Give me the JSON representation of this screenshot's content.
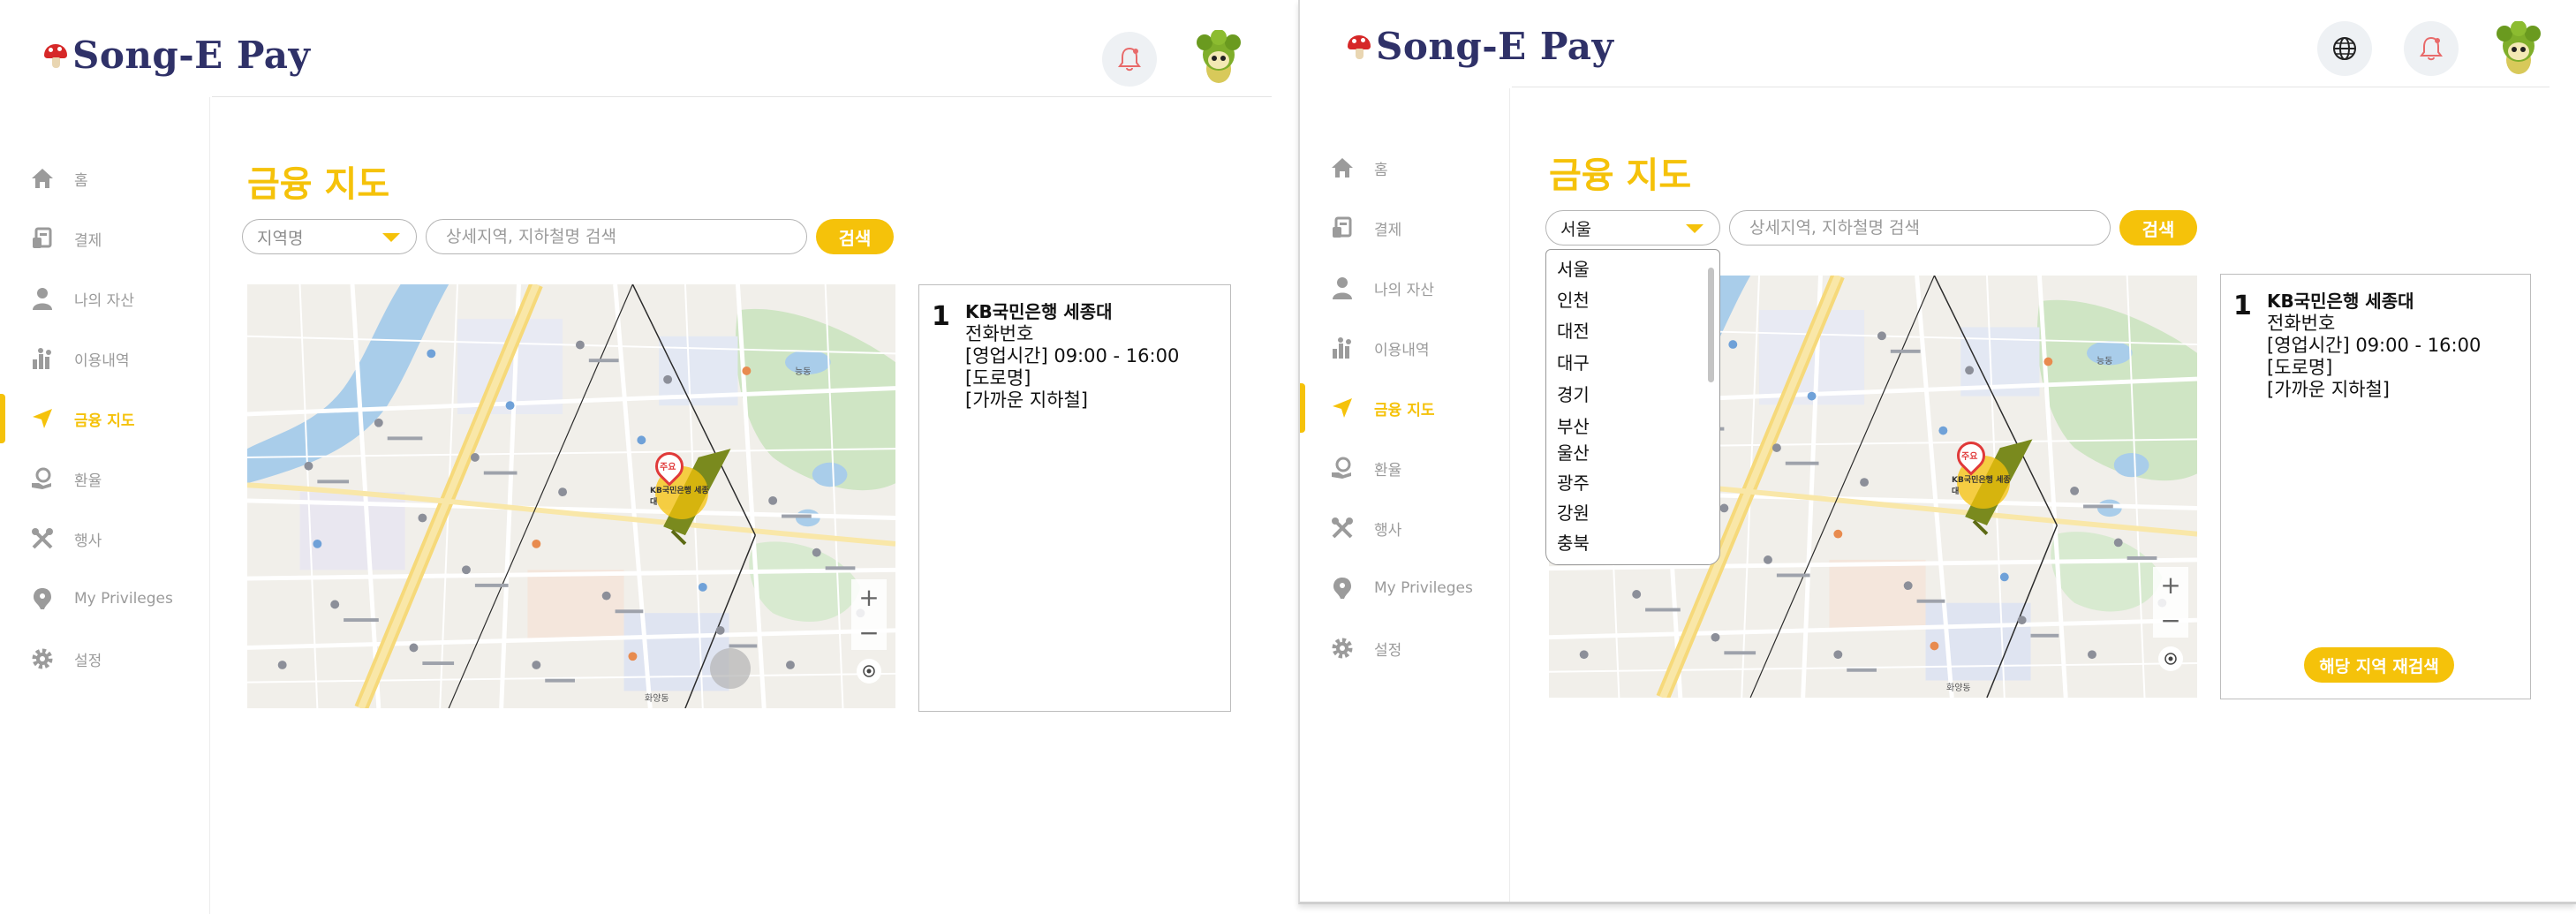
{
  "app": {
    "name": "Song-E Pay",
    "brand_color": "#2f3168",
    "accent_color": "#f5c20a"
  },
  "nav_left": [
    {
      "label": "홈",
      "icon": "home-icon",
      "active": false
    },
    {
      "label": "결제",
      "icon": "payment-icon",
      "active": false
    },
    {
      "label": "나의 자산",
      "icon": "user-icon",
      "active": false
    },
    {
      "label": "이용내역",
      "icon": "history-icon",
      "active": false
    },
    {
      "label": "금융 지도",
      "icon": "navigation-icon",
      "active": true
    },
    {
      "label": "환율",
      "icon": "exchange-icon",
      "active": false
    },
    {
      "label": "행사",
      "icon": "tools-icon",
      "active": false
    },
    {
      "label": "My Privileges",
      "icon": "privilege-icon",
      "active": false
    },
    {
      "label": "설정",
      "icon": "gear-icon",
      "active": false
    }
  ],
  "nav_right": [
    {
      "label": "홈",
      "icon": "home-icon",
      "active": false
    },
    {
      "label": "결제",
      "icon": "payment-icon",
      "active": false
    },
    {
      "label": "나의 자산",
      "icon": "user-icon",
      "active": false
    },
    {
      "label": "이용내역",
      "icon": "history-icon",
      "active": false
    },
    {
      "label": "금융 지도",
      "icon": "navigation-icon",
      "active": true
    },
    {
      "label": "환율",
      "icon": "exchange-icon",
      "active": false
    },
    {
      "label": "행사",
      "icon": "tools-icon",
      "active": false
    },
    {
      "label": "My Privileges",
      "icon": "privilege-icon",
      "active": false
    },
    {
      "label": "설정",
      "icon": "gear-icon",
      "active": false
    }
  ],
  "left": {
    "title": "금융 지도",
    "region_placeholder": "지역명",
    "search_placeholder": "상세지역, 지하철명 검색",
    "search_button": "검색",
    "result": {
      "num": "1",
      "name": "KB국민은행 세종대",
      "phone": "전화번호",
      "hours": "[영업시간] 09:00 - 16:00",
      "road": "[도로명]",
      "subway": "[가까운 지하철]"
    }
  },
  "right": {
    "title": "금융 지도",
    "region_selected": "서울",
    "region_options": [
      "서울",
      "인천",
      "대전",
      "대구",
      "경기",
      "부산",
      "울산",
      "광주",
      "강원",
      "충북"
    ],
    "search_placeholder": "상세지역, 지하철명 검색",
    "search_button": "검색",
    "result": {
      "num": "1",
      "name": "KB국민은행 세종대",
      "phone": "전화번호",
      "hours": "[영업시간] 09:00 - 16:00",
      "road": "[도로명]",
      "subway": "[가까운 지하철]"
    },
    "research_button": "해당 지역 재검색"
  },
  "map": {
    "marker_label": "KB국민은행 세종대",
    "marker_badge": "주요",
    "zoom_in": "+",
    "zoom_out": "−",
    "area_label_1": "화양동",
    "area_label_2": "능동"
  }
}
